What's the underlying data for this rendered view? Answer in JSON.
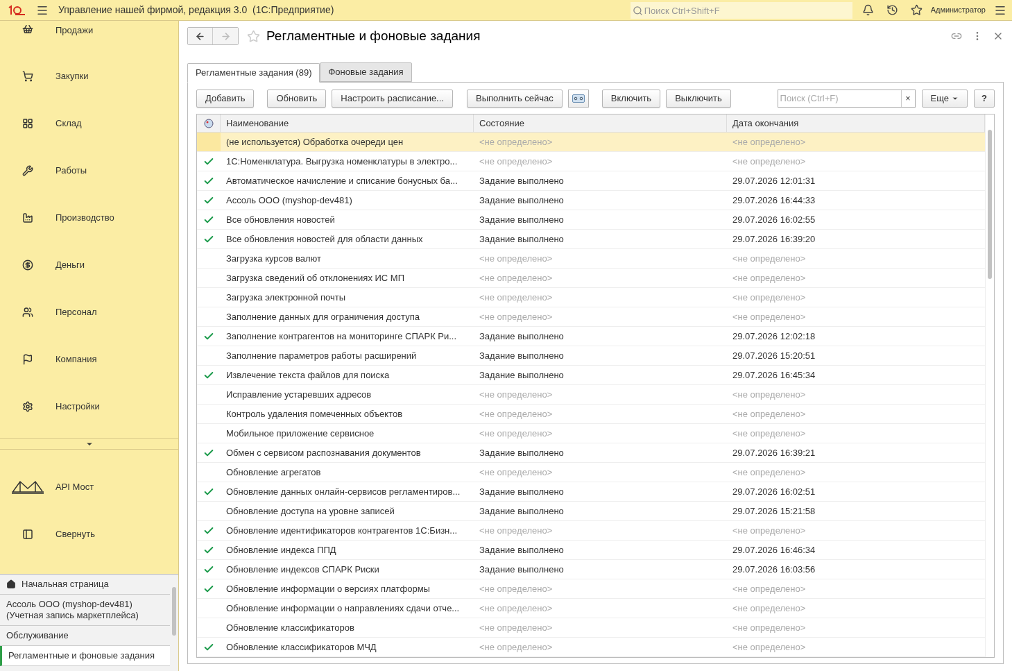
{
  "app_bar": {
    "title": "Управление нашей фирмой, редакция 3.0  (1С:Предприятие)",
    "search": {
      "placeholder": "Поиск Ctrl+Shift+F"
    },
    "user": "Администратор"
  },
  "sidebar": {
    "sections": [
      {
        "label": "Продажи"
      },
      {
        "label": "Закупки"
      },
      {
        "label": "Склад"
      },
      {
        "label": "Работы"
      },
      {
        "label": "Производство"
      },
      {
        "label": "Деньги"
      },
      {
        "label": "Персонал"
      },
      {
        "label": "Компания"
      },
      {
        "label": "Настройки"
      }
    ],
    "extra": [
      {
        "label": "API Мост"
      },
      {
        "label": "Свернуть"
      }
    ],
    "open_windows": [
      {
        "label": "Начальная страница",
        "kind": "home",
        "selected": false
      },
      {
        "label": "Ассоль ООО (myshop-dev481)\n(Учетная запись маркетплейса)",
        "kind": "window",
        "selected": false
      },
      {
        "label": "Обслуживание",
        "kind": "window",
        "selected": false
      },
      {
        "label": "Регламентные и фоновые задания",
        "kind": "window",
        "selected": true
      }
    ]
  },
  "form": {
    "title": "Регламентные и фоновые задания",
    "tabs": [
      {
        "label": "Регламентные задания (89)",
        "selected": true
      },
      {
        "label": "Фоновые задания",
        "selected": false
      }
    ],
    "buttons": [
      "Добавить",
      "Обновить",
      "Настроить расписание...",
      "Выполнить сейчас"
    ],
    "buttons_2": [
      "Включить",
      "Выключить"
    ],
    "search": {
      "placeholder": "Поиск (Ctrl+F)",
      "clear": "×"
    },
    "more": "Еще",
    "help": "?",
    "table": {
      "columns": [
        "Наименование",
        "Состояние",
        "Дата окончания"
      ],
      "rows": [
        {
          "enabled": false,
          "name": "(не используется) Обработка очереди цен",
          "state": "<не определено>",
          "date": "<не определено>",
          "greyed": true,
          "selected": true
        },
        {
          "enabled": true,
          "name": "1С:Номенклатура. Выгрузка номенклатуры в электро...",
          "state": "<не определено>",
          "date": "<не определено>",
          "greyed": true,
          "selected": false
        },
        {
          "enabled": true,
          "name": "Автоматическое начисление и списание бонусных ба...",
          "state": "Задание выполнено",
          "date": "29.07.2026 12:01:31",
          "greyed": false,
          "selected": false
        },
        {
          "enabled": true,
          "name": "Ассоль ООО (myshop-dev481)",
          "state": "Задание выполнено",
          "date": "29.07.2026 16:44:33",
          "greyed": false,
          "selected": false
        },
        {
          "enabled": true,
          "name": "Все обновления новостей",
          "state": "Задание выполнено",
          "date": "29.07.2026 16:02:55",
          "greyed": false,
          "selected": false
        },
        {
          "enabled": true,
          "name": "Все обновления новостей для области данных",
          "state": "Задание выполнено",
          "date": "29.07.2026 16:39:20",
          "greyed": false,
          "selected": false
        },
        {
          "enabled": false,
          "name": "Загрузка курсов валют",
          "state": "<не определено>",
          "date": "<не определено>",
          "greyed": true,
          "selected": false
        },
        {
          "enabled": false,
          "name": "Загрузка сведений об отклонениях ИС МП",
          "state": "<не определено>",
          "date": "<не определено>",
          "greyed": true,
          "selected": false
        },
        {
          "enabled": false,
          "name": "Загрузка электронной почты",
          "state": "<не определено>",
          "date": "<не определено>",
          "greyed": true,
          "selected": false
        },
        {
          "enabled": false,
          "name": "Заполнение данных для ограничения доступа",
          "state": "<не определено>",
          "date": "<не определено>",
          "greyed": true,
          "selected": false
        },
        {
          "enabled": true,
          "name": "Заполнение контрагентов на мониторинге СПАРК Ри...",
          "state": "Задание выполнено",
          "date": "29.07.2026 12:02:18",
          "greyed": false,
          "selected": false
        },
        {
          "enabled": false,
          "name": "Заполнение параметров работы расширений",
          "state": "Задание выполнено",
          "date": "29.07.2026 15:20:51",
          "greyed": false,
          "selected": false
        },
        {
          "enabled": true,
          "name": "Извлечение текста файлов для поиска",
          "state": "Задание выполнено",
          "date": "29.07.2026 16:45:34",
          "greyed": false,
          "selected": false
        },
        {
          "enabled": false,
          "name": "Исправление устаревших адресов",
          "state": "<не определено>",
          "date": "<не определено>",
          "greyed": true,
          "selected": false
        },
        {
          "enabled": false,
          "name": "Контроль удаления помеченных объектов",
          "state": "<не определено>",
          "date": "<не определено>",
          "greyed": true,
          "selected": false
        },
        {
          "enabled": false,
          "name": "Мобильное приложение сервисное",
          "state": "<не определено>",
          "date": "<не определено>",
          "greyed": true,
          "selected": false
        },
        {
          "enabled": true,
          "name": "Обмен с сервисом распознавания документов",
          "state": "Задание выполнено",
          "date": "29.07.2026 16:39:21",
          "greyed": false,
          "selected": false
        },
        {
          "enabled": false,
          "name": "Обновление агрегатов",
          "state": "<не определено>",
          "date": "<не определено>",
          "greyed": true,
          "selected": false
        },
        {
          "enabled": true,
          "name": "Обновление данных онлайн-сервисов регламентиров...",
          "state": "Задание выполнено",
          "date": "29.07.2026 16:02:51",
          "greyed": false,
          "selected": false
        },
        {
          "enabled": false,
          "name": "Обновление доступа на уровне записей",
          "state": "Задание выполнено",
          "date": "29.07.2026 15:21:58",
          "greyed": false,
          "selected": false
        },
        {
          "enabled": true,
          "name": "Обновление идентификаторов контрагентов 1С:Бизн...",
          "state": "<не определено>",
          "date": "<не определено>",
          "greyed": true,
          "selected": false
        },
        {
          "enabled": true,
          "name": "Обновление индекса ППД",
          "state": "Задание выполнено",
          "date": "29.07.2026 16:46:34",
          "greyed": false,
          "selected": false
        },
        {
          "enabled": true,
          "name": "Обновление индексов СПАРК Риски",
          "state": "Задание выполнено",
          "date": "29.07.2026 16:03:56",
          "greyed": false,
          "selected": false
        },
        {
          "enabled": true,
          "name": "Обновление информации о версиях платформы",
          "state": "<не определено>",
          "date": "<не определено>",
          "greyed": true,
          "selected": false
        },
        {
          "enabled": false,
          "name": "Обновление информации о направлениях сдачи отче...",
          "state": "<не определено>",
          "date": "<не определено>",
          "greyed": true,
          "selected": false
        },
        {
          "enabled": false,
          "name": "Обновление классификаторов",
          "state": "<не определено>",
          "date": "<не определено>",
          "greyed": true,
          "selected": false
        },
        {
          "enabled": true,
          "name": "Обновление классификаторов МЧД",
          "state": "<не определено>",
          "date": "<не определено>",
          "greyed": true,
          "selected": false
        }
      ]
    }
  }
}
